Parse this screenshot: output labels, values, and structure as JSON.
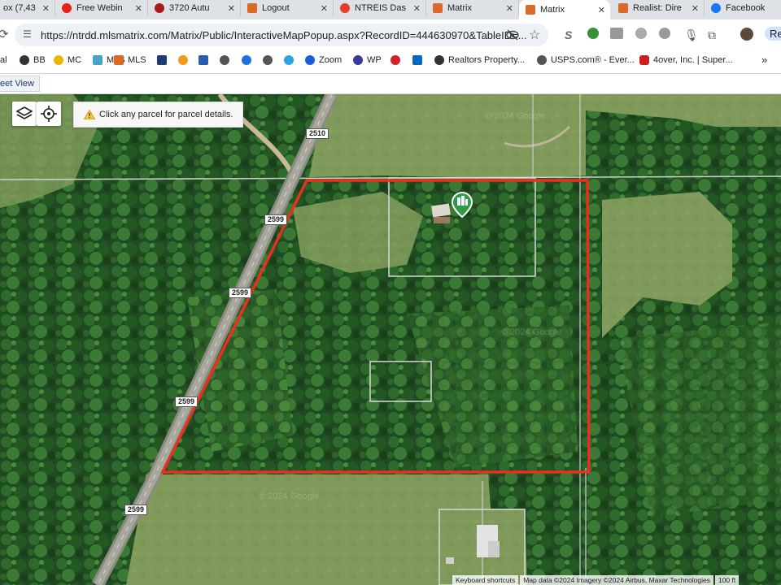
{
  "tabs": [
    {
      "label": "ox (7,43"
    },
    {
      "label": "Free Webin"
    },
    {
      "label": "3720 Autu"
    },
    {
      "label": "Logout"
    },
    {
      "label": "NTREIS Das"
    },
    {
      "label": "Matrix"
    },
    {
      "label": "Matrix"
    },
    {
      "label": "Realist: Dire"
    },
    {
      "label": "Facebook"
    }
  ],
  "address_bar": {
    "url": "https://ntrdd.mlsmatrix.com/Matrix/Public/InteractiveMapPopup.aspx?RecordID=444630970&TableID=...",
    "profile_label": "Re"
  },
  "bookmarks": [
    "al",
    "BB",
    "MC",
    "MLS",
    "",
    "",
    "",
    "",
    "",
    "",
    "Zoom",
    "WP",
    "",
    "",
    "Realtors Property...",
    "USPS.com® - Ever...",
    "4over, Inc. | Super..."
  ],
  "page": {
    "street_view_label": "eet View"
  },
  "map": {
    "notice": "Click any parcel for parcel details.",
    "road_labels": [
      "2510",
      "2599",
      "2599",
      "2599",
      "2599"
    ],
    "watermarks": [
      "© 2024 Google",
      "© 2024 Google",
      "© 2024 Google"
    ],
    "footer": {
      "keyboard": "Keyboard shortcuts",
      "attribution": "Map data ©2024 Imagery ©2024 Airbus, Maxar Technologies",
      "scale": "100 ft"
    },
    "colors": {
      "boundary": "#e8301f",
      "pin": "#2e9b4a"
    }
  }
}
